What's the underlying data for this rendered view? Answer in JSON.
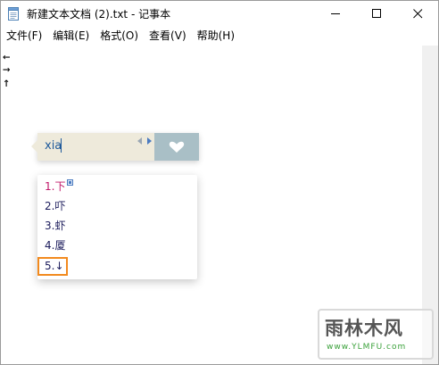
{
  "window": {
    "title": "新建文本文档 (2).txt - 记事本"
  },
  "menu": {
    "items": [
      {
        "label": "文件(F)"
      },
      {
        "label": "编辑(E)"
      },
      {
        "label": "格式(O)"
      },
      {
        "label": "查看(V)"
      },
      {
        "label": "帮助(H)"
      }
    ]
  },
  "editor": {
    "lines": [
      "←",
      "→",
      "↑"
    ]
  },
  "ime": {
    "input_text": "xia",
    "candidates": [
      {
        "label": "1.下",
        "active": true
      },
      {
        "label": "2.吓",
        "active": false
      },
      {
        "label": "3.虾",
        "active": false
      },
      {
        "label": "4.厦",
        "active": false
      },
      {
        "label": "5.↓",
        "active": false
      }
    ],
    "highlighted_index": 4,
    "highlight_color": "#f28a1e",
    "active_color": "#c2186a"
  },
  "watermark": {
    "main": "雨林木风",
    "sub": "www.YLMFU.com"
  }
}
